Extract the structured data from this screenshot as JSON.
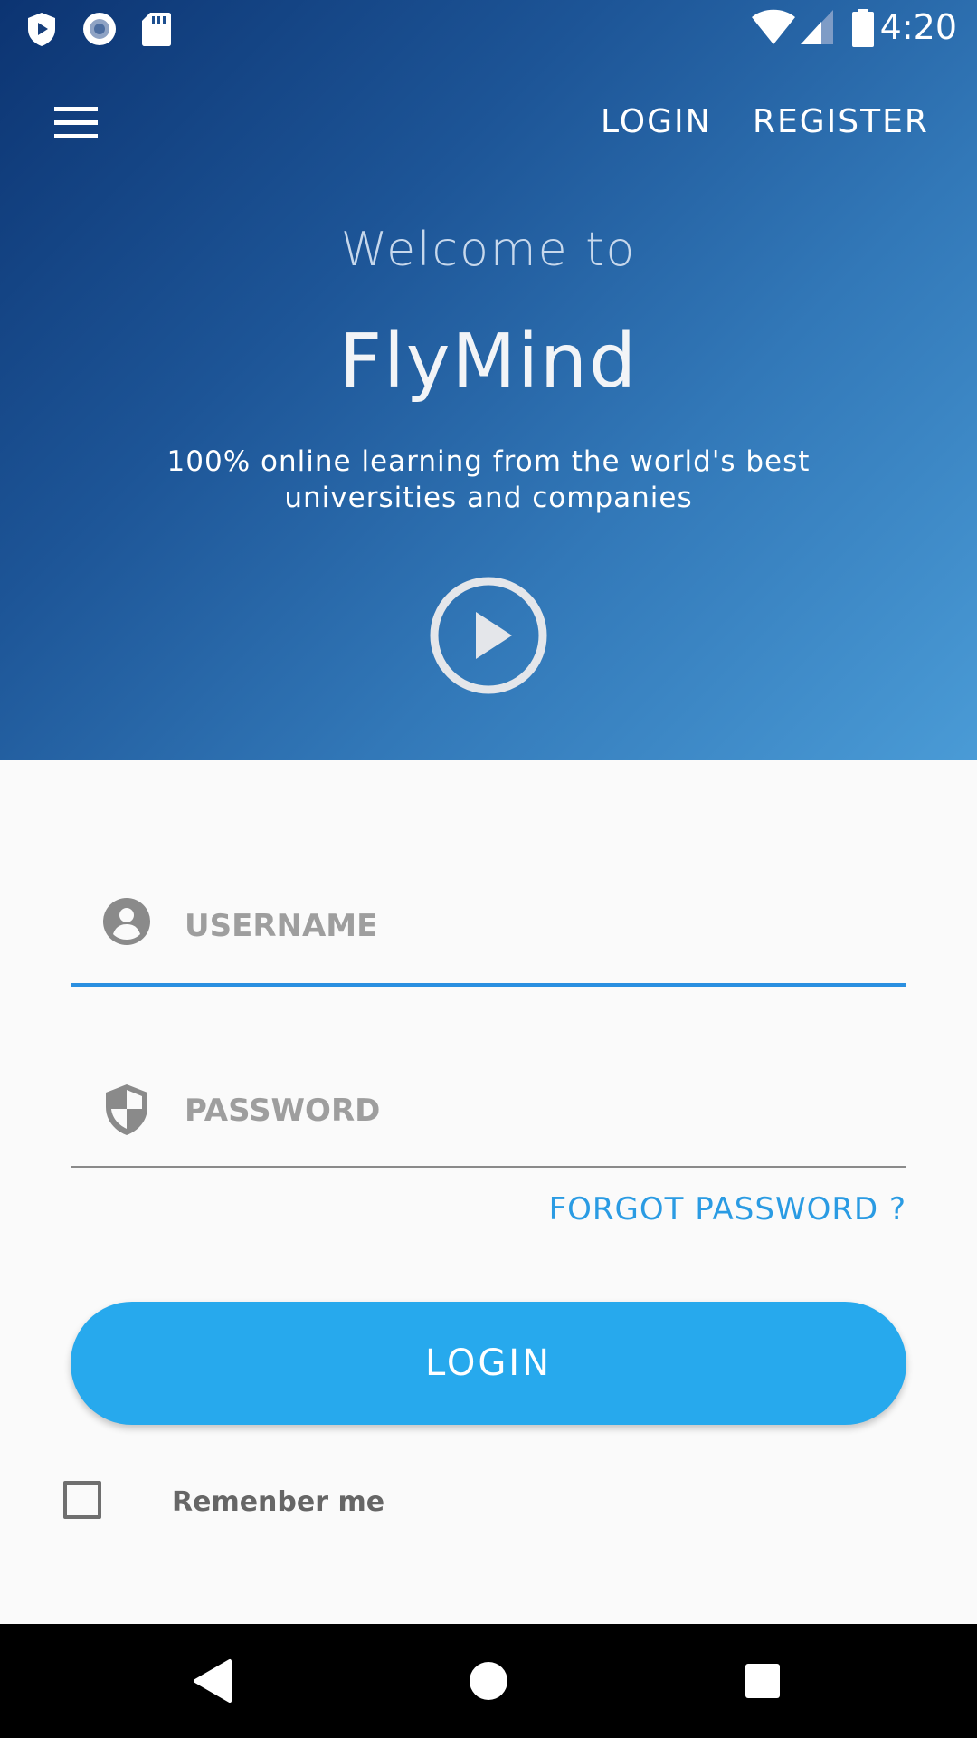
{
  "status_bar": {
    "time": "4:20",
    "icons": [
      "shield-play-icon",
      "record-icon",
      "sd-card-icon",
      "wifi-icon",
      "signal-icon",
      "battery-icon"
    ]
  },
  "app_bar": {
    "menu_icon": "hamburger-menu-icon",
    "login_link": "LOGIN",
    "register_link": "REGISTER"
  },
  "hero": {
    "welcome": "Welcome to",
    "brand": "FlyMind",
    "tagline": "100% online learning from the world's best universities and companies",
    "play_icon": "play-circle-icon"
  },
  "form": {
    "username": {
      "placeholder": "USERNAME",
      "value": "",
      "icon": "account-circle-icon"
    },
    "password": {
      "placeholder": "PASSWORD",
      "value": "",
      "icon": "shield-icon"
    },
    "forgot_password": "FORGOT PASSWORD ?",
    "login_button": "LOGIN",
    "remember_me": {
      "label": "Remenber me",
      "checked": false
    }
  },
  "nav_bar": {
    "icons": [
      "back-icon",
      "home-icon",
      "recents-icon"
    ]
  },
  "colors": {
    "accent": "#27a9ed",
    "link": "#2a9be3",
    "underline_active": "#2a8fe0",
    "hero_start": "#0c3472",
    "hero_end": "#4a9bd6"
  }
}
